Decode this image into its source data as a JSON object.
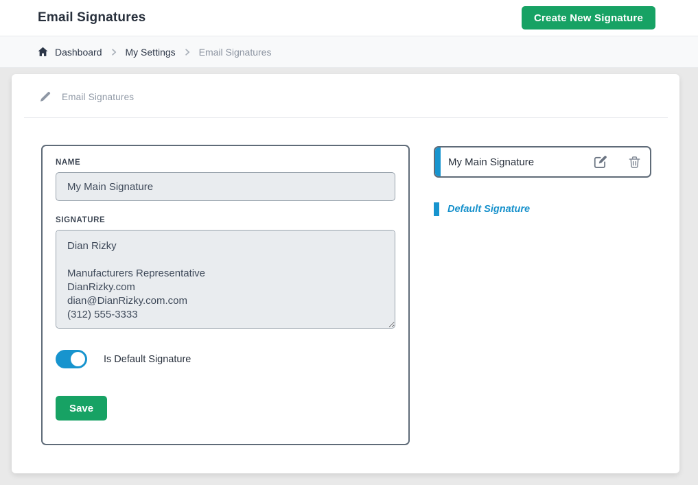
{
  "header": {
    "title": "Email Signatures",
    "create_button": "Create New Signature"
  },
  "breadcrumb": {
    "items": [
      {
        "label": "Dashboard"
      },
      {
        "label": "My Settings"
      },
      {
        "label": "Email Signatures"
      }
    ]
  },
  "card": {
    "title": "Email Signatures"
  },
  "form": {
    "name_label": "NAME",
    "name_value": "My Main Signature",
    "signature_label": "SIGNATURE",
    "signature_value": "Dian Rizky\n\nManufacturers Representative\nDianRizky.com\ndian@DianRizky.com.com\n(312) 555-3333",
    "toggle_label": "Is Default Signature",
    "toggle_state": "on",
    "save_label": "Save"
  },
  "signature_list": {
    "items": [
      {
        "name": "My Main Signature",
        "is_default": true
      }
    ],
    "default_badge": "Default Signature"
  },
  "colors": {
    "green": "#17a264",
    "blue": "#1794ce",
    "blue_text": "#1590cb",
    "dark_text": "#28303c",
    "panel_border": "#5f6b78",
    "input_bg": "#e9ecef"
  }
}
